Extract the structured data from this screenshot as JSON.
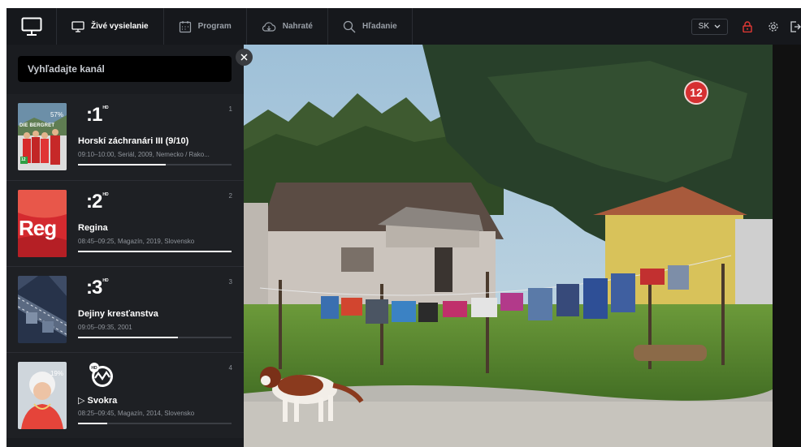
{
  "nav": {
    "items": [
      {
        "label": "Živé vysielanie",
        "icon": "tv-icon",
        "active": true
      },
      {
        "label": "Program",
        "icon": "calendar-icon",
        "active": false
      },
      {
        "label": "Nahraté",
        "icon": "cloud-icon",
        "active": false
      },
      {
        "label": "Hľadanie",
        "icon": "search-icon",
        "active": false
      }
    ],
    "language": "SK",
    "accent": "#e53935"
  },
  "panel": {
    "search_placeholder": "Vyhľadajte kanál",
    "channels": [
      {
        "number": "1",
        "logo": ":1",
        "title": "Horskí záchranári III (9/10)",
        "meta": "09:10–10:00, Seriál, 2009, Nemecko / Rako...",
        "progress_percent": 57,
        "progress_label": "57%",
        "thumb_text": "DIE BERGRET",
        "thumb_badge": "12"
      },
      {
        "number": "2",
        "logo": ":2",
        "title": "Regina",
        "meta": "08:45–09:25, Magazín, 2019, Slovensko",
        "progress_percent": 100,
        "thumb_text": "Reg"
      },
      {
        "number": "3",
        "logo": ":3",
        "title": "Dejiny kresťanstva",
        "meta": "09:05–09:35, 2001",
        "progress_percent": 65
      },
      {
        "number": "4",
        "logo": "HD",
        "title": "Svokra",
        "title_prefix": "▷",
        "meta": "08:25–09:45, Magazín, 2014, Slovensko",
        "progress_percent": 19,
        "progress_label": "19%"
      }
    ]
  },
  "video": {
    "age_rating": "12"
  }
}
